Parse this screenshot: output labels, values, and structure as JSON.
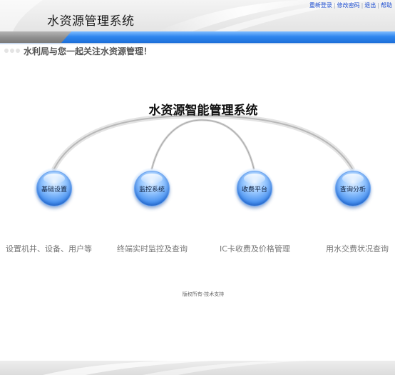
{
  "header": {
    "title": "水资源管理系统",
    "links": [
      {
        "label": "重新登录"
      },
      {
        "label": "修改密码"
      },
      {
        "label": "退出"
      },
      {
        "label": "帮助"
      }
    ],
    "separator": "|"
  },
  "welcome": {
    "text": "水利局与您一起关注水资源管理！"
  },
  "main": {
    "system_title": "水资源智能管理系统",
    "modules": [
      {
        "label": "基础设置",
        "description": "设置机井、设备、用户等"
      },
      {
        "label": "监控系统",
        "description": "终端实时监控及查询"
      },
      {
        "label": "收费平台",
        "description": "IC卡收费及价格管理"
      },
      {
        "label": "查询分析",
        "description": "用水交费状况查询"
      }
    ]
  },
  "footer": {
    "text": "版权所有-技术支持"
  },
  "colors": {
    "link_blue": "#1f4fd1",
    "stripe_blue": "#2f86ee",
    "node_blue": "#3d8aee",
    "description_gray": "#777777"
  }
}
